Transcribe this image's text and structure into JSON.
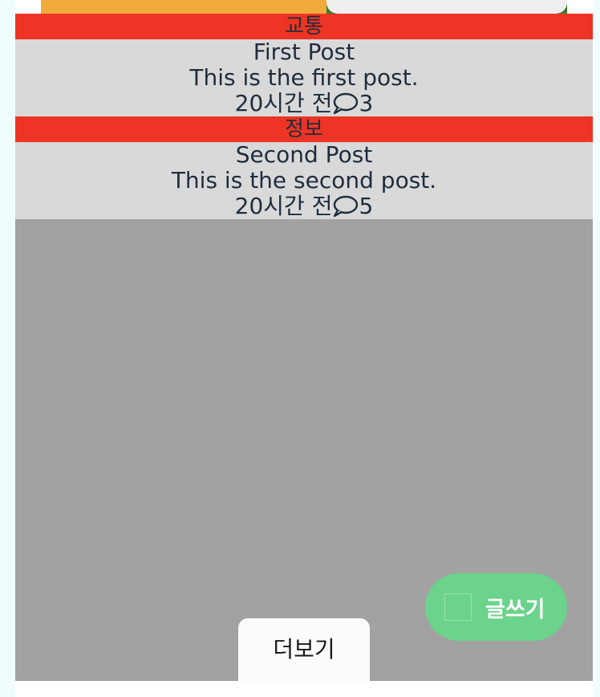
{
  "posts": [
    {
      "category": "교통",
      "title": "First Post",
      "body": "This is the first post.",
      "time": "20시간 전",
      "comment_count": "3"
    },
    {
      "category": "정보",
      "title": "Second Post",
      "body": "This is the second post.",
      "time": "20시간 전",
      "comment_count": "5"
    }
  ],
  "fab": {
    "label": "글쓰기",
    "icon": "write-icon"
  },
  "more_button": {
    "label": "더보기"
  },
  "colors": {
    "category_bg": "#ee3424",
    "post_bg": "#d9d9d9",
    "text": "#1e2d3d",
    "overlay": "#a2a2a2",
    "fab_bg": "#6bd38b",
    "tab_left": "#f1ab3c",
    "tab_strip": "#3a7d2a"
  }
}
